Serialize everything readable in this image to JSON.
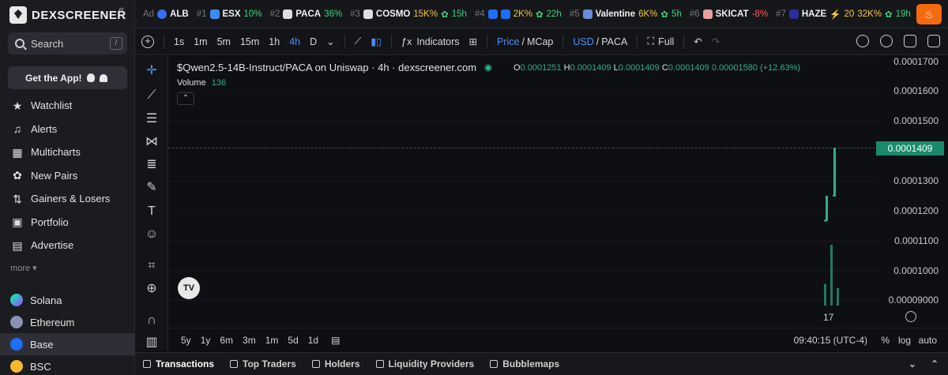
{
  "sidebar": {
    "logo": "DEXSCREENER",
    "search_label": "Search",
    "search_key": "/",
    "get_app": "Get the App!",
    "nav": [
      {
        "label": "Watchlist",
        "icon": "star-icon"
      },
      {
        "label": "Alerts",
        "icon": "bell-icon"
      },
      {
        "label": "Multicharts",
        "icon": "grid-icon"
      },
      {
        "label": "New Pairs",
        "icon": "seedling-icon"
      },
      {
        "label": "Gainers & Losers",
        "icon": "arrows-icon"
      },
      {
        "label": "Portfolio",
        "icon": "wallet-icon"
      },
      {
        "label": "Advertise",
        "icon": "ad-icon"
      }
    ],
    "more": "more",
    "chains": [
      {
        "label": "Solana",
        "color": "#9945ff"
      },
      {
        "label": "Ethereum",
        "color": "#8a92b2"
      },
      {
        "label": "Base",
        "color": "#1f6cf5"
      },
      {
        "label": "BSC",
        "color": "#f3ba2f"
      }
    ]
  },
  "ticker": {
    "ad_label": "Ad",
    "ad_symbol": "ALB",
    "items": [
      {
        "rank": "#1",
        "symbol": "ESX",
        "change": "10%",
        "extra": "",
        "color": "#3a8cff"
      },
      {
        "rank": "#2",
        "symbol": "PACA",
        "change": "36%",
        "extra": "",
        "color": "#dedede"
      },
      {
        "rank": "#3",
        "symbol": "COSMO",
        "change": "15K%",
        "extra": "15h",
        "color": "#dedede"
      },
      {
        "rank": "#4",
        "symbol": "",
        "change": "2K%",
        "extra": "22h",
        "color": "#1f6cf5"
      },
      {
        "rank": "#5",
        "symbol": "Valentine",
        "change": "6K%",
        "extra": "5h",
        "color": "#6b8bd6"
      },
      {
        "rank": "#6",
        "symbol": "SKICAT",
        "change": "-8%",
        "extra": "",
        "color": "#e6a0a0"
      },
      {
        "rank": "#7",
        "symbol": "HAZE",
        "change": "32K%",
        "extra": "19h",
        "boost": "20",
        "color": "#2d2d9a"
      }
    ]
  },
  "toolbar": {
    "intervals": [
      "1s",
      "1m",
      "5m",
      "15m",
      "1h",
      "4h",
      "D"
    ],
    "active_interval": "4h",
    "indicators": "Indicators",
    "price": "Price",
    "mcap": "MCap",
    "usd": "USD",
    "paca": "PACA",
    "full": "Full"
  },
  "chart": {
    "title": "$Qwen2.5-14B-Instruct/PACA on Uniswap · 4h · dexscreener.com",
    "ohlc": {
      "o": "0.0001251",
      "h": "0.0001409",
      "l": "0.0001409",
      "c": "0.0001409",
      "change": "0.00001580 (+12.63%)"
    },
    "volume_label": "Volume",
    "volume_value": "136",
    "price_ticks": [
      "0.0001700",
      "0.0001600",
      "0.0001500",
      "0.0001300",
      "0.0001200",
      "0.0001100",
      "0.0001000",
      "0.00009000"
    ],
    "current_price": "0.0001409",
    "x_tick": "17",
    "logo": "TV"
  },
  "chart_data": {
    "type": "candlestick",
    "candles": [
      {
        "o": 0.0001169,
        "h": 0.0001251,
        "l": 0.0001169,
        "c": 0.0001251
      },
      {
        "o": 0.0001251,
        "h": 0.0001409,
        "l": 0.0001251,
        "c": 0.0001409
      }
    ],
    "ylim": [
      8.85e-05,
      0.000171
    ],
    "x_label": "17"
  },
  "ranges": {
    "items": [
      "5y",
      "1y",
      "6m",
      "3m",
      "1m",
      "5d",
      "1d"
    ],
    "time": "09:40:15 (UTC-4)",
    "pct": "%",
    "log": "log",
    "auto": "auto"
  },
  "tabs": {
    "items": [
      "Transactions",
      "Top Traders",
      "Holders",
      "Liquidity Providers",
      "Bubblemaps"
    ]
  }
}
